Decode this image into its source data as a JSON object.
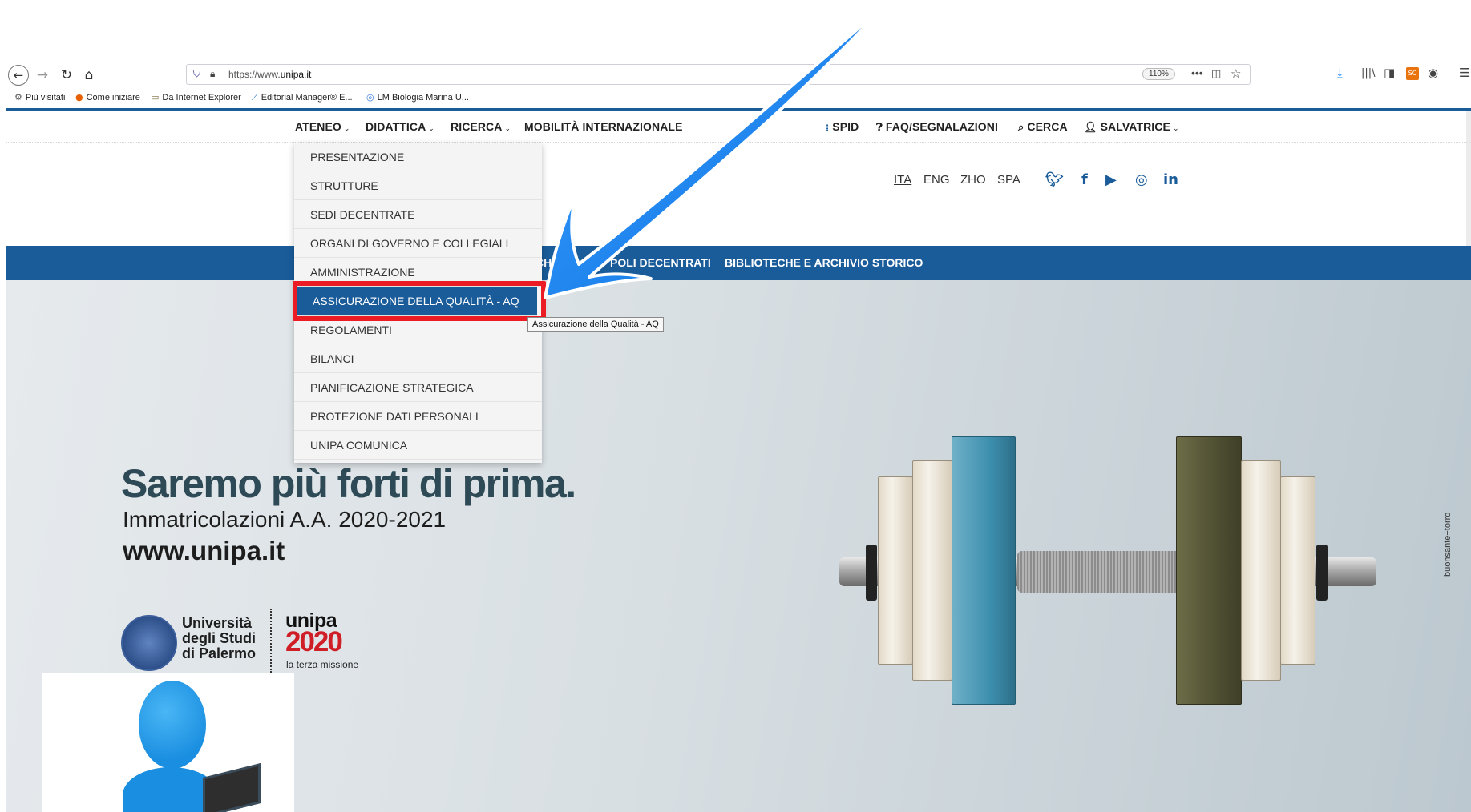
{
  "browser": {
    "url": "https://www.unipa.it",
    "url_prefix": "https://www.",
    "url_domain": "unipa.it",
    "zoom": "110%",
    "icons": {
      "back": "arrow-left-icon",
      "forward": "arrow-right-icon",
      "reload": "reload-icon",
      "home": "home-icon",
      "download": "download-icon",
      "library": "library-icon",
      "sidebar": "sidebar-icon",
      "account": "account-icon",
      "menu": "hamburger-menu-icon"
    },
    "extension_badge": "SC",
    "bookmarks": [
      {
        "label": "Più visitati"
      },
      {
        "label": "Come iniziare"
      },
      {
        "label": "Da Internet Explorer"
      },
      {
        "label": "Editorial Manager® E..."
      },
      {
        "label": "LM Biologia Marina U..."
      }
    ]
  },
  "topnav": {
    "left": [
      {
        "label": "ATENEO"
      },
      {
        "label": "DIDATTICA"
      },
      {
        "label": "RICERCA"
      },
      {
        "label": "MOBILITÀ INTERNAZIONALE"
      }
    ],
    "right": [
      {
        "label": "SPID"
      },
      {
        "label": "FAQ/SEGNALAZIONI"
      },
      {
        "label": "CERCA"
      },
      {
        "label": "SALVATRICE"
      }
    ]
  },
  "languages": [
    "ITA",
    "ENG",
    "ZHO",
    "SPA"
  ],
  "social": [
    "twitter-icon",
    "facebook-icon",
    "youtube-icon",
    "instagram-icon",
    "linkedin-icon"
  ],
  "bluebar": {
    "fragment": "CHI",
    "item_poli": "POLI DECENTRATI",
    "item_biblioteche": "BIBLIOTECHE E ARCHIVIO STORICO"
  },
  "dropdown": {
    "items": [
      "PRESENTAZIONE",
      "STRUTTURE",
      "SEDI DECENTRATE",
      "ORGANI DI GOVERNO E COLLEGIALI",
      "AMMINISTRAZIONE",
      "ASSICURAZIONE DELLA QUALITÀ - AQ",
      "REGOLAMENTI",
      "BILANCI",
      "PIANIFICAZIONE STRATEGICA",
      "PROTEZIONE DATI PERSONALI",
      "UNIPA COMUNICA"
    ],
    "highlighted_index": 5,
    "tooltip": "Assicurazione della Qualità - AQ"
  },
  "hero": {
    "title": "Saremo più forti di prima.",
    "subtitle": "Immatricolazioni A.A. 2020-2021",
    "url": "www.unipa.it",
    "university_name": [
      "Università",
      "degli Studi",
      "di Palermo"
    ],
    "unipa_word": "unipa",
    "unipa_year": "2020",
    "unipa_tagline": "la terza missione",
    "credit": "buonsante+torro"
  },
  "colors": {
    "brand_blue": "#1a5b99",
    "highlight_red": "#ec1c24",
    "arrow_blue": "#0a6fe0",
    "unipa_red": "#d01e26"
  }
}
